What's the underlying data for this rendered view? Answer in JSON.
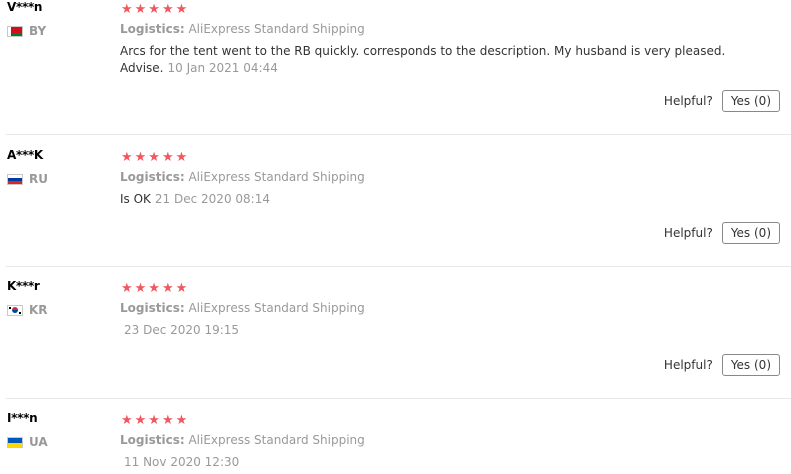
{
  "reviews": [
    {
      "name": "V***n",
      "country": "BY",
      "stars": "★★★★★",
      "logistics_label": "Logistics:",
      "logistics_value": "AliExpress Standard Shipping",
      "text": "Arcs for the tent went to the RB quickly. corresponds to the description. My husband is very pleased. Advise.",
      "date": "10 Jan 2021 04:44",
      "helpful_label": "Helpful?",
      "yes_label": "Yes (0)"
    },
    {
      "name": "A***K",
      "country": "RU",
      "stars": "★★★★★",
      "logistics_label": "Logistics:",
      "logistics_value": "AliExpress Standard Shipping",
      "text": "Is OK",
      "date": "21 Dec 2020 08:14",
      "helpful_label": "Helpful?",
      "yes_label": "Yes (0)"
    },
    {
      "name": "K***r",
      "country": "KR",
      "stars": "★★★★★",
      "logistics_label": "Logistics:",
      "logistics_value": "AliExpress Standard Shipping",
      "text": "",
      "date": "23 Dec 2020 19:15",
      "helpful_label": "Helpful?",
      "yes_label": "Yes (0)"
    },
    {
      "name": "I***n",
      "country": "UA",
      "stars": "★★★★★",
      "logistics_label": "Logistics:",
      "logistics_value": "AliExpress Standard Shipping",
      "text": "",
      "date": "11 Nov 2020 12:30"
    }
  ],
  "colors": {
    "star": "#f0575f",
    "muted": "#999999",
    "separator": "#e8e8e8"
  },
  "icons": [
    "flag-by-icon",
    "flag-ru-icon",
    "flag-kr-icon",
    "flag-ua-icon"
  ]
}
